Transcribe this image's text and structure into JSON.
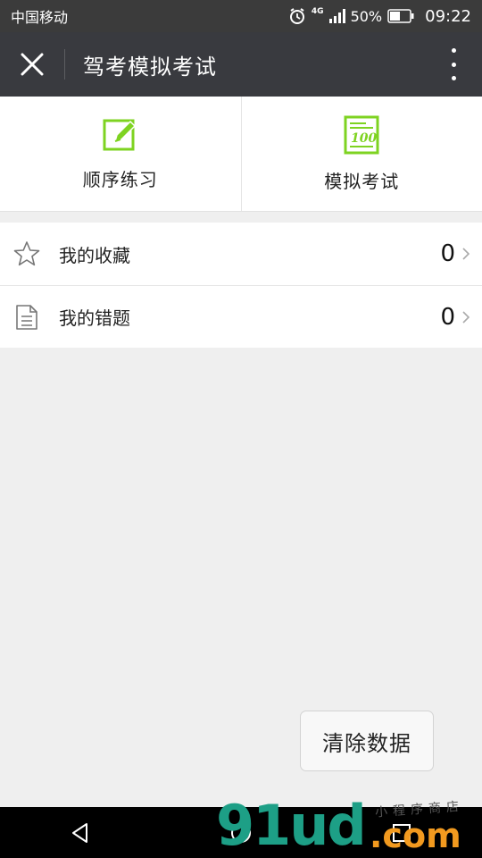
{
  "status_bar": {
    "carrier": "中国移动",
    "network": "4G",
    "battery": "50%",
    "time": "09:22"
  },
  "header": {
    "title": "驾考模拟考试"
  },
  "cards": [
    {
      "label": "顺序练习",
      "icon": "edit-pencil-icon"
    },
    {
      "label": "模拟考试",
      "icon": "exam-score-100-icon"
    }
  ],
  "list": [
    {
      "label": "我的收藏",
      "count": "0",
      "icon": "star-icon"
    },
    {
      "label": "我的错题",
      "count": "0",
      "icon": "document-icon"
    }
  ],
  "actions": {
    "clear_label": "清除数据"
  },
  "watermark": {
    "brand_main": "91ud",
    "brand_suffix": ".com",
    "brand_tagline": "小程序商店"
  },
  "colors": {
    "accent_green": "#7ed321",
    "header_bg": "#393a3f",
    "watermark_teal": "#1d9f86",
    "watermark_orange": "#f29a1f"
  }
}
